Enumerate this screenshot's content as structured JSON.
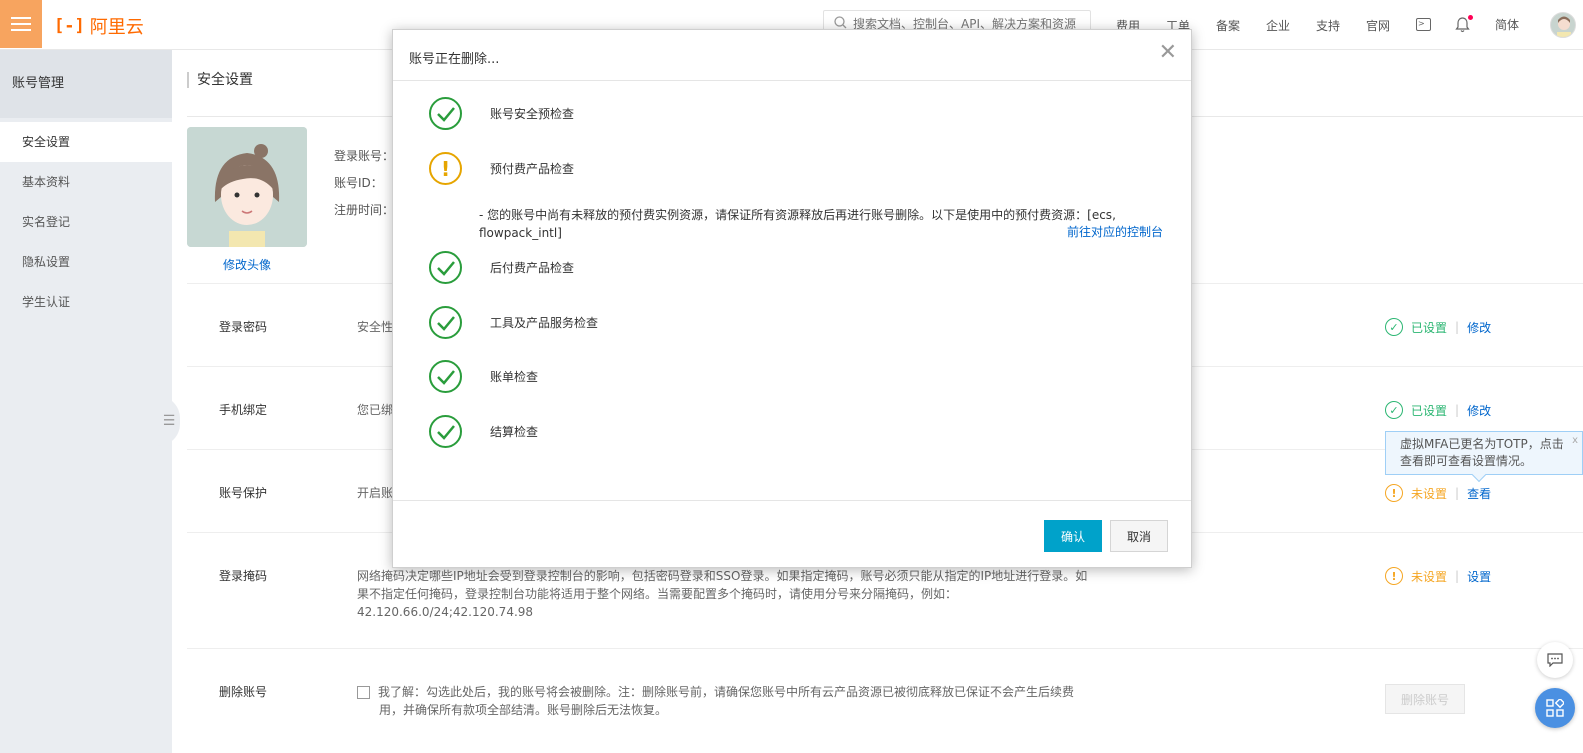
{
  "header": {
    "brand": "阿里云",
    "brand_mark": "[-]",
    "search_placeholder": "搜索文档、控制台、API、解决方案和资源",
    "nav": [
      "费用",
      "工单",
      "备案",
      "企业",
      "支持",
      "官网"
    ],
    "lang": "简体"
  },
  "sidebar": {
    "title": "账号管理",
    "items": [
      {
        "label": "安全设置"
      },
      {
        "label": "基本资料"
      },
      {
        "label": "实名登记"
      },
      {
        "label": "隐私设置"
      },
      {
        "label": "学生认证"
      }
    ]
  },
  "main": {
    "page_title": "安全设置",
    "avatar_link": "修改头像",
    "info": {
      "login_account": "登录账号：",
      "account_id": "账号ID：",
      "register_time": "注册时间："
    },
    "rows": [
      {
        "label": "登录密码",
        "desc": "安全性",
        "status": "已设置",
        "action": "修改"
      },
      {
        "label": "手机绑定",
        "desc": "您已绑",
        "status": "已设置",
        "action": "修改"
      },
      {
        "label": "账号保护",
        "desc": "开启账",
        "status": "未设置",
        "action": "查看"
      },
      {
        "label": "登录掩码",
        "desc": "网络掩码决定哪些IP地址会受到登录控制台的影响，包括密码登录和SSO登录。如果指定掩码，账号必须只能从指定的IP地址进行登录。如果不指定任何掩码，登录控制台功能将适用于整个网络。当需要配置多个掩码时，请使用分号来分隔掩码，例如：42.120.66.0/24;42.120.74.98",
        "status": "未设置",
        "action": "设置"
      }
    ],
    "delete": {
      "label": "删除账号",
      "desc": "我了解：勾选此处后，我的账号将会被删除。注：删除账号前，请确保您账号中所有云产品资源已被彻底释放已保证不会产生后续费用，并确保所有款项全部结清。账号删除后无法恢复。",
      "button": "删除账号"
    },
    "tooltip": "虚拟MFA已更名为TOTP，点击查看即可查看设置情况。"
  },
  "modal": {
    "title": "账号正在删除...",
    "checks": [
      {
        "label": "账号安全预检查",
        "status": "ok"
      },
      {
        "label": "预付费产品检查",
        "status": "warn"
      },
      {
        "label": "后付费产品检查",
        "status": "ok"
      },
      {
        "label": "工具及产品服务检查",
        "status": "ok"
      },
      {
        "label": "账单检查",
        "status": "ok"
      },
      {
        "label": "结算检查",
        "status": "ok"
      }
    ],
    "warn_detail": "- 您的账号中尚有未释放的预付费实例资源，请保证所有资源释放后再进行账号删除。以下是使用中的预付费资源：[ecs, flowpack_intl]",
    "console_link": "前往对应的控制台",
    "confirm": "确认",
    "cancel": "取消"
  },
  "colors": {
    "brand": "#ff6a00",
    "ok": "#2a9d3c",
    "warn": "#e6a500",
    "primary": "#00a2ca",
    "link": "#0066cc"
  }
}
